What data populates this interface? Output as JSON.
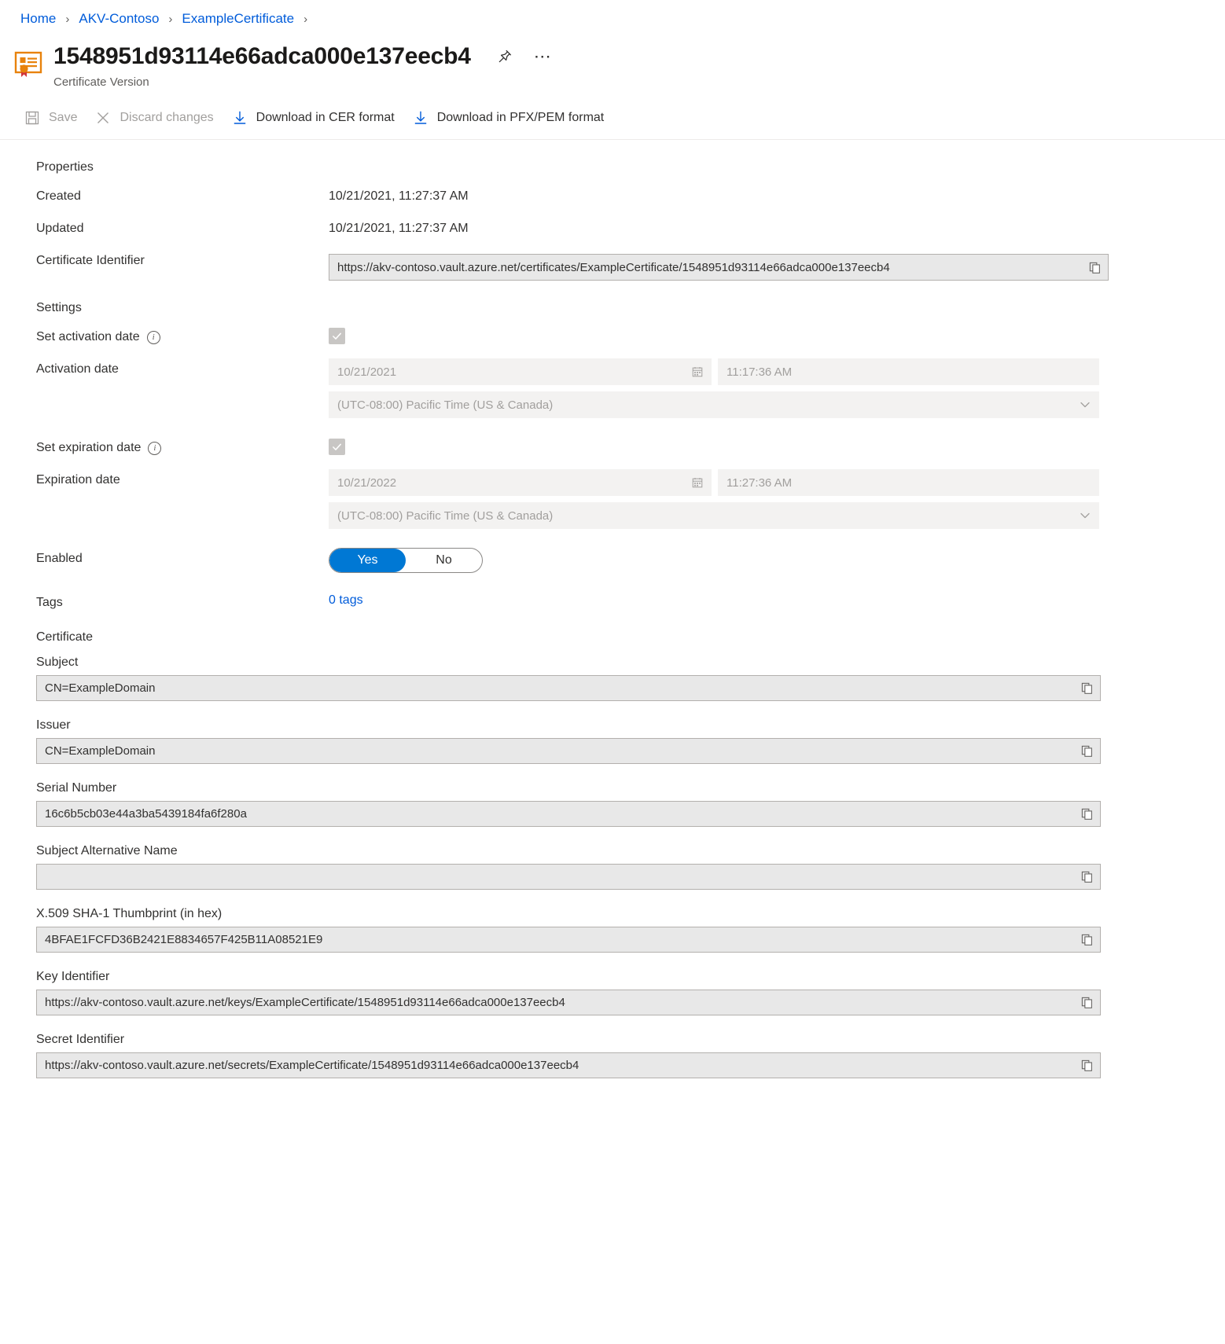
{
  "breadcrumb": {
    "items": [
      {
        "label": "Home"
      },
      {
        "label": "AKV-Contoso"
      },
      {
        "label": "ExampleCertificate"
      }
    ],
    "separator": "›"
  },
  "header": {
    "title": "1548951d93114e66adca000e137eecb4",
    "subtitle": "Certificate Version",
    "pin_icon": "pin-icon",
    "more_icon": "ellipsis-icon"
  },
  "commandbar": {
    "items": [
      {
        "label": "Save",
        "icon": "save-icon",
        "disabled": true
      },
      {
        "label": "Discard changes",
        "icon": "close-icon",
        "disabled": true
      },
      {
        "label": "Download in CER format",
        "icon": "download-icon",
        "disabled": false
      },
      {
        "label": "Download in PFX/PEM format",
        "icon": "download-icon",
        "disabled": false
      }
    ]
  },
  "properties": {
    "heading": "Properties",
    "created_label": "Created",
    "created_value": "10/21/2021, 11:27:37 AM",
    "updated_label": "Updated",
    "updated_value": "10/21/2021, 11:27:37 AM",
    "certificate_identifier_label": "Certificate Identifier",
    "certificate_identifier_value": "https://akv-contoso.vault.azure.net/certificates/ExampleCertificate/1548951d93114e66adca000e137eecb4"
  },
  "settings": {
    "heading": "Settings",
    "set_activation_date_label": "Set activation date",
    "set_activation_date_checked": true,
    "activation_date_label": "Activation date",
    "activation_date_value": "10/21/2021",
    "activation_time_value": "11:17:36 AM",
    "activation_timezone_value": "(UTC-08:00) Pacific Time (US & Canada)",
    "set_expiration_date_label": "Set expiration date",
    "set_expiration_date_checked": true,
    "expiration_date_label": "Expiration date",
    "expiration_date_value": "10/21/2022",
    "expiration_time_value": "11:27:36 AM",
    "expiration_timezone_value": "(UTC-08:00) Pacific Time (US & Canada)",
    "enabled_label": "Enabled",
    "enabled_yes": "Yes",
    "enabled_no": "No",
    "enabled_selected": "Yes",
    "tags_label": "Tags",
    "tags_value": "0 tags"
  },
  "certificate": {
    "heading": "Certificate",
    "fields": [
      {
        "label": "Subject",
        "value": "CN=ExampleDomain"
      },
      {
        "label": "Issuer",
        "value": "CN=ExampleDomain"
      },
      {
        "label": "Serial Number",
        "value": "16c6b5cb03e44a3ba5439184fa6f280a"
      },
      {
        "label": "Subject Alternative Name",
        "value": ""
      },
      {
        "label": "X.509 SHA-1 Thumbprint (in hex)",
        "value": "4BFAE1FCFD36B2421E8834657F425B11A08521E9"
      },
      {
        "label": "Key Identifier",
        "value": "https://akv-contoso.vault.azure.net/keys/ExampleCertificate/1548951d93114e66adca000e137eecb4"
      },
      {
        "label": "Secret Identifier",
        "value": "https://akv-contoso.vault.azure.net/secrets/ExampleCertificate/1548951d93114e66adca000e137eecb4"
      }
    ]
  },
  "colors": {
    "link": "#015cda",
    "accent": "#0078d4",
    "text": "#323130",
    "disabled_text": "#a19f9d",
    "field_readonly_bg": "#e8e8e8",
    "field_disabled_bg": "#f3f2f1"
  }
}
